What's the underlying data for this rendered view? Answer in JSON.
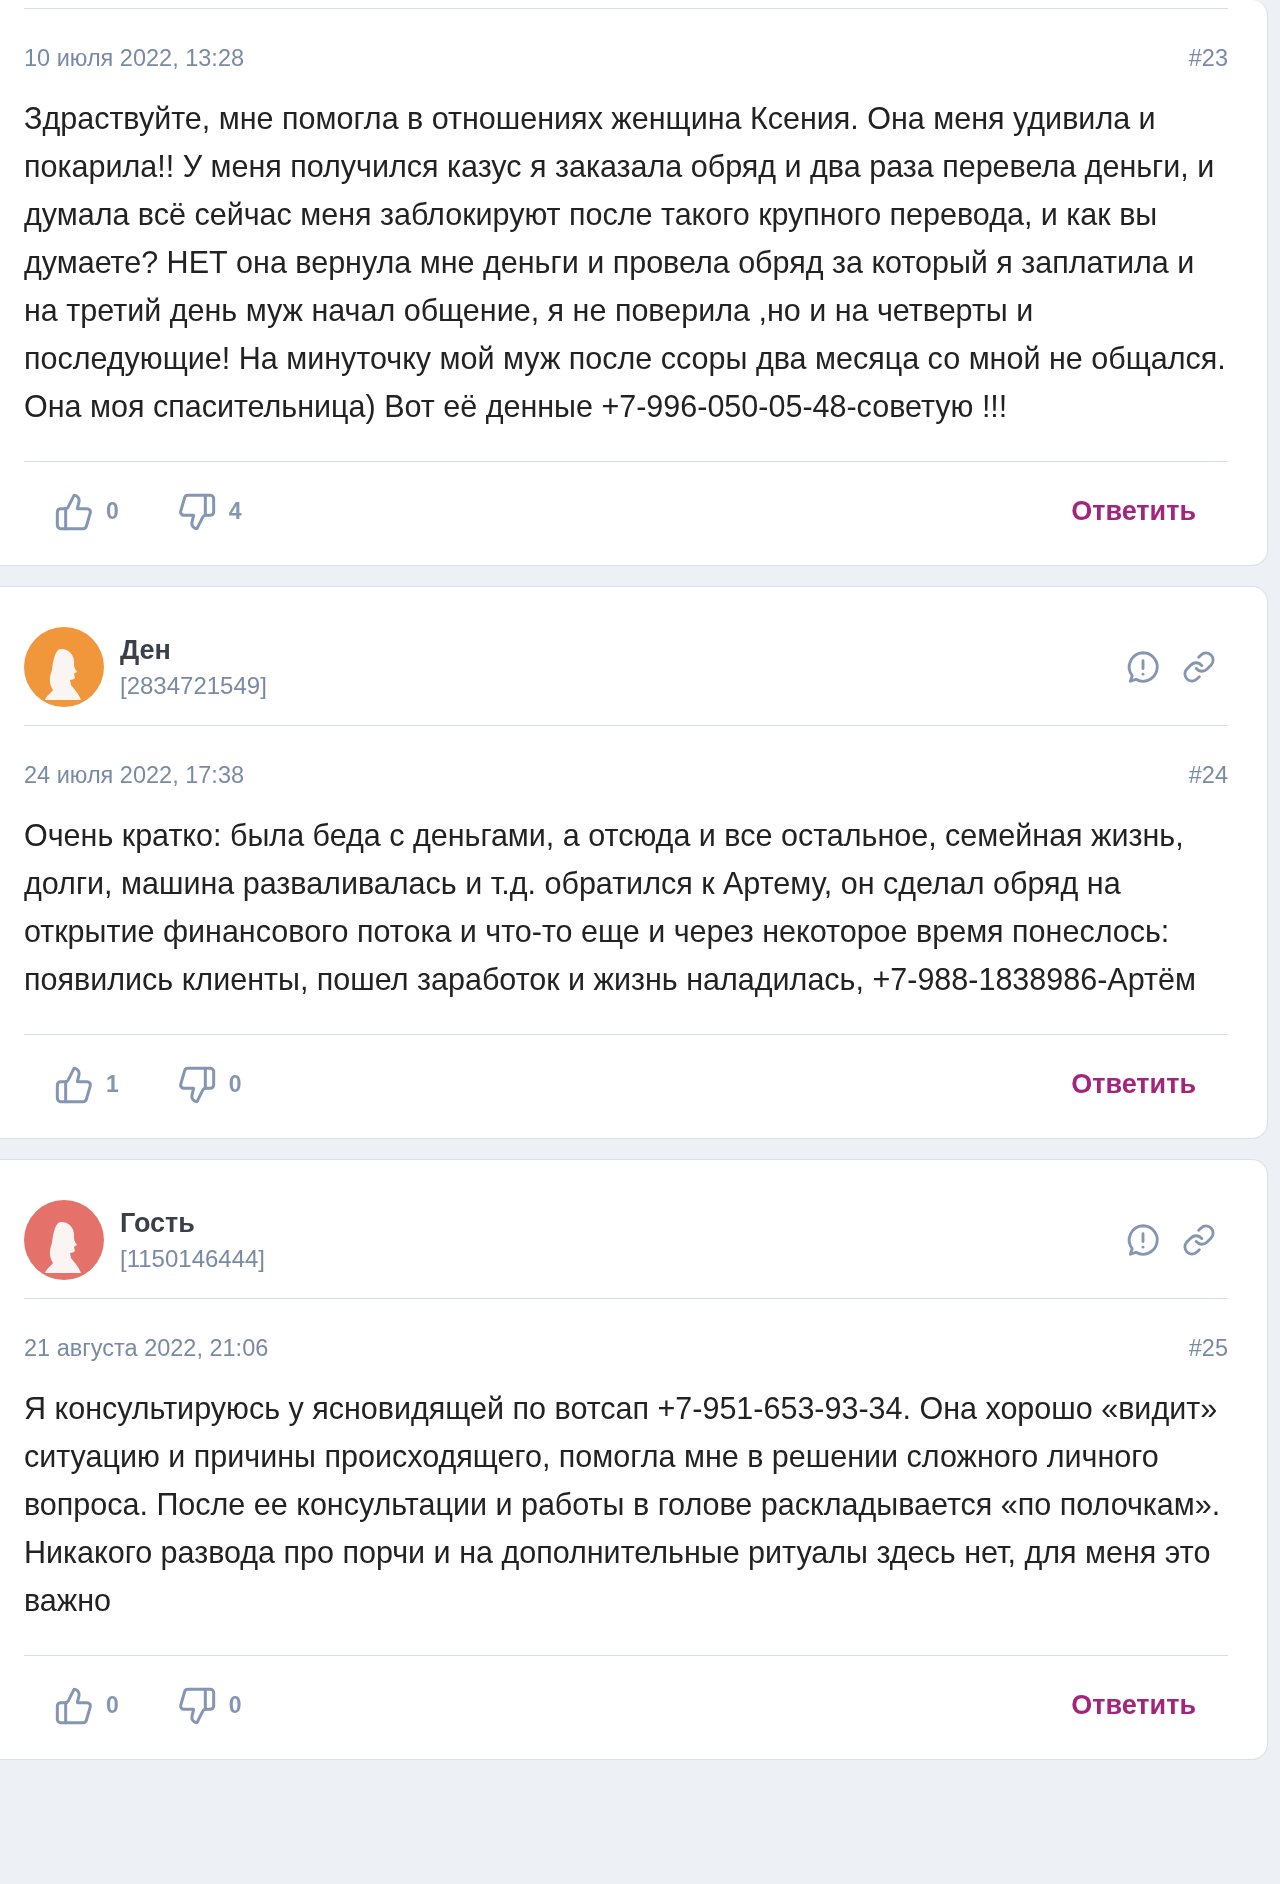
{
  "comments": [
    {
      "date": "10 июля 2022, 13:28",
      "number": "#23",
      "text": "Здраствуйте, мне помогла в отношениях женщина Ксения. Она меня удивила и покарила!! У меня получился казус я заказала обряд и два раза перевела деньги, и думала всё сейчас меня заблокируют после такого крупного перевода, и как вы думаете? НЕТ она вернула мне деньги и провела обряд за который я заплатила и на третий день муж начал общение, я не поверила ,но и на четверты и последующие! На минуточку мой муж после ссоры два месяца со мной не общался. Она моя спасительница) Вот её денные +7-996-050-05-48-советую !!!",
      "likes": "0",
      "dislikes": "4",
      "reply": "Ответить"
    },
    {
      "author": {
        "name": "Ден",
        "id": "[2834721549]",
        "color": "#f0973b"
      },
      "date": "24 июля 2022, 17:38",
      "number": "#24",
      "text": "Очень кратко: была беда с деньгами, а отсюда и все остальное, семейная жизнь, долги, машина разваливалась и т.д. обратился к Артему, он сделал обряд на открытие финансового потока и что-то еще и через некоторое время понеслось: появились клиенты, пошел заработок и жизнь наладилась, +7-988-1838986-Артём",
      "likes": "1",
      "dislikes": "0",
      "reply": "Ответить"
    },
    {
      "author": {
        "name": "Гость",
        "id": "[1150146444]",
        "color": "#e5716b"
      },
      "date": "21 августа 2022, 21:06",
      "number": "#25",
      "text": "Я консультируюсь у ясновидящей по вотсап +7-951-653-93-34. Она хорошо «видит» ситуацию и причины происходящего, помогла мне в решении сложного личного вопроса. После ее консультации и работы в голове раскладывается «по полочкам». Никакого развода про порчи и на дополнительные ритуалы здесь нет, для меня это важно",
      "likes": "0",
      "dislikes": "0",
      "reply": "Ответить"
    }
  ]
}
